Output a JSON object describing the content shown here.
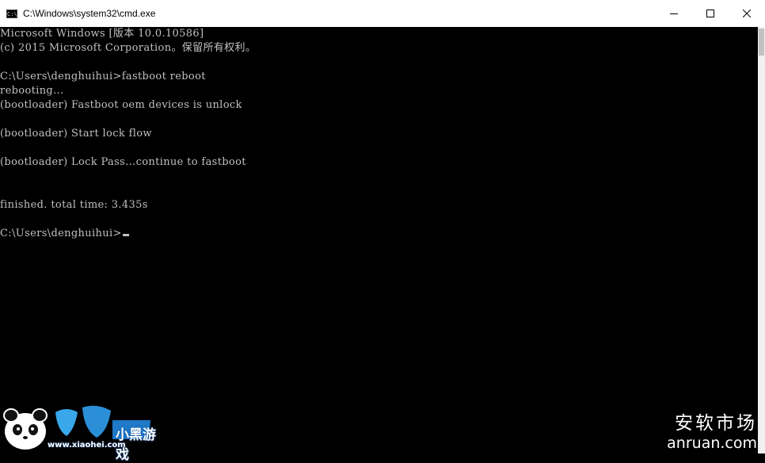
{
  "window": {
    "title": "C:\\Windows\\system32\\cmd.exe",
    "icon": "cmd-icon",
    "controls": [
      "minimize-icon",
      "maximize-icon",
      "close-icon"
    ]
  },
  "console": {
    "lines": [
      "Microsoft Windows [版本 10.0.10586]",
      "(c) 2015 Microsoft Corporation。保留所有权利。",
      "",
      "C:\\Users\\denghuihui>fastboot reboot",
      "rebooting...",
      "(bootloader) Fastboot oem devices is unlock",
      "",
      "(bootloader) Start lock flow",
      "",
      "(bootloader) Lock Pass...continue to fastboot",
      "",
      "",
      "finished. total time: 3.435s",
      "",
      "C:\\Users\\denghuihui>"
    ]
  },
  "watermarks": {
    "right_cn": "安软市场",
    "right_en": "anruan.com",
    "left_logo": "小黑游戏",
    "left_url": "www.xiaohei.com"
  }
}
